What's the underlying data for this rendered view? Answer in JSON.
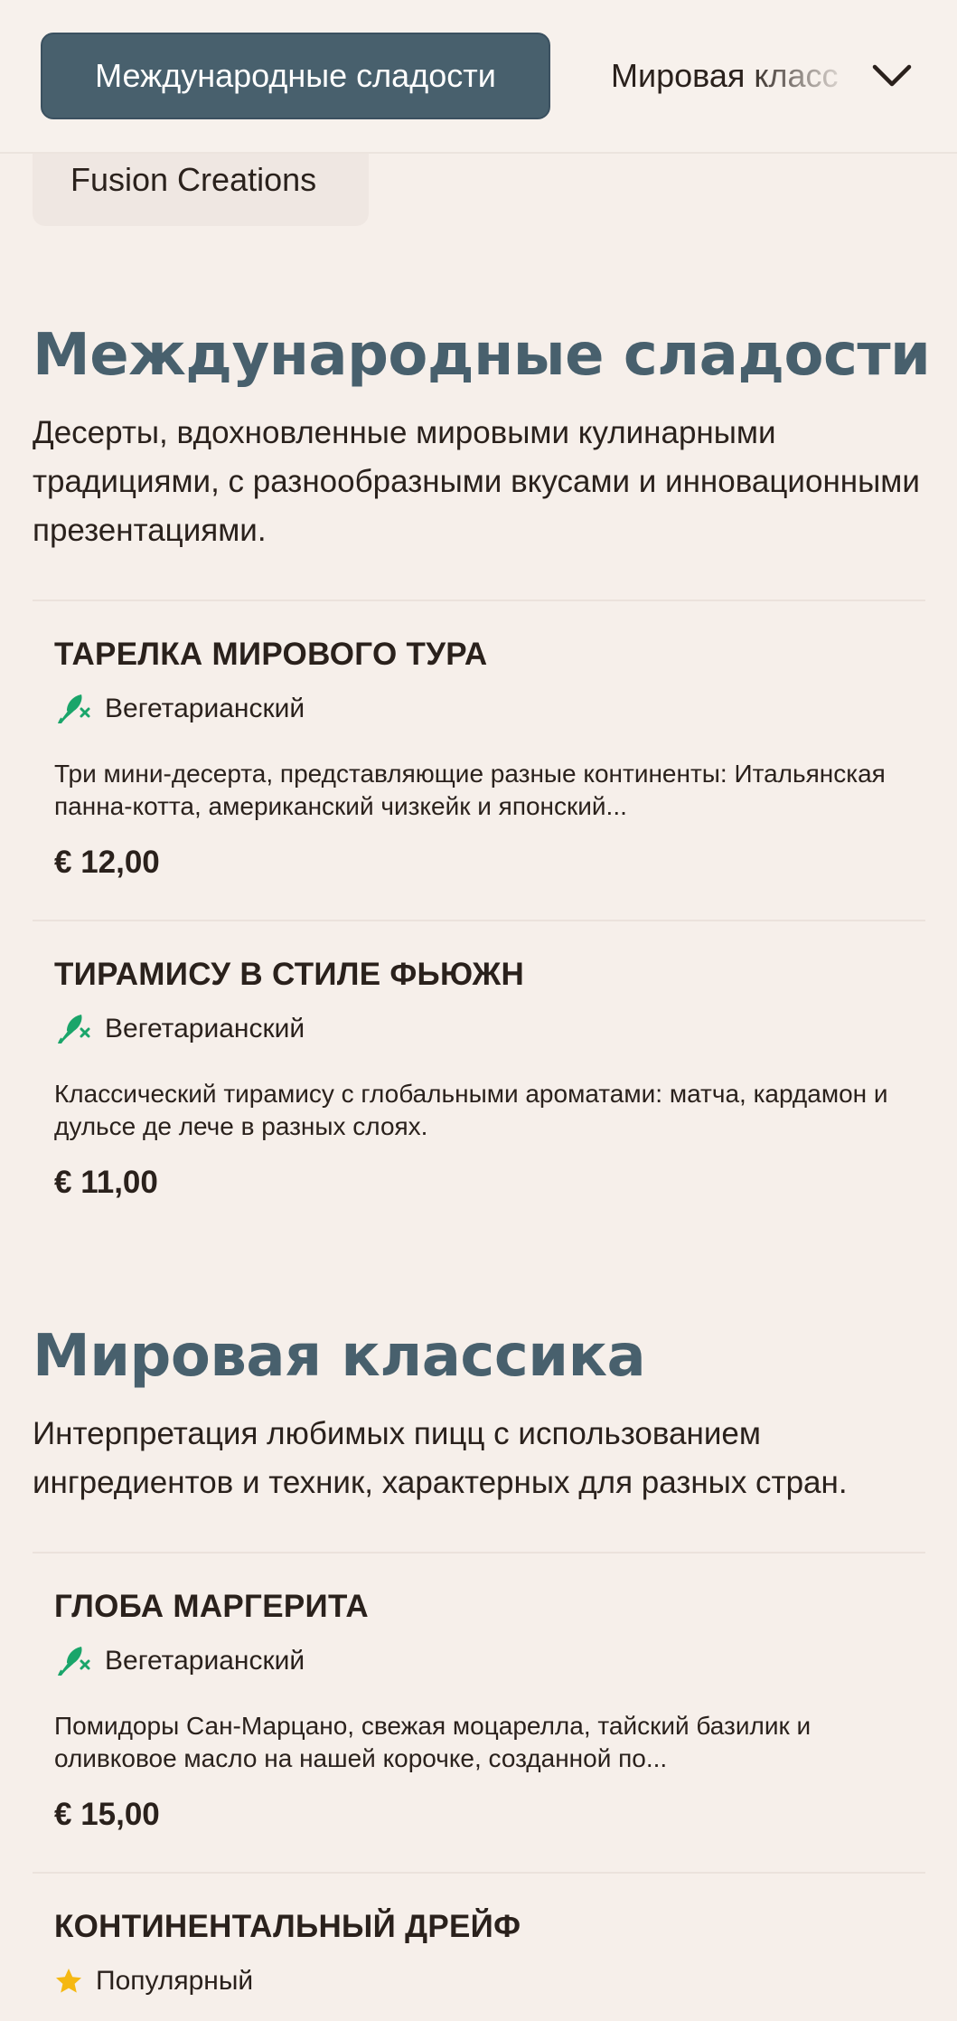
{
  "nav": {
    "active_tab": "Международные сладости",
    "next_tab": "Мировая класс",
    "chip": "Fusion Creations"
  },
  "sections": [
    {
      "title": "Международные сладости",
      "description": "Десерты, вдохновленные мировыми кулинарными традициями, с разнообразными вкусами и инновационными презентациями.",
      "items": [
        {
          "name": "ТАРЕЛКА МИРОВОГО ТУРА",
          "tag": "Вегетарианский",
          "tag_icon": "vegetarian-icon",
          "description": "Три мини-десерта, представляющие разные континенты: Итальянская панна-котта, американский чизкейк и японский...",
          "price": "€ 12,00"
        },
        {
          "name": "ТИРАМИСУ В СТИЛЕ ФЬЮЖН",
          "tag": "Вегетарианский",
          "tag_icon": "vegetarian-icon",
          "description": "Классический тирамису с глобальными ароматами: матча, кардамон и дульсе де лече в разных слоях.",
          "price": "€ 11,00"
        }
      ]
    },
    {
      "title": "Мировая классика",
      "description": "Интерпретация любимых пицц с использованием ингредиентов и техник, характерных для разных стран.",
      "items": [
        {
          "name": "ГЛОБА МАРГЕРИТА",
          "tag": "Вегетарианский",
          "tag_icon": "vegetarian-icon",
          "description": "Помидоры Сан-Марцано, свежая моцарелла, тайский базилик и оливковое масло на нашей корочке, созданной по...",
          "price": "€ 15,00"
        },
        {
          "name": "КОНТИНЕНТАЛЬНЫЙ ДРЕЙФ",
          "tag": "Популярный",
          "tag_icon": "star-icon"
        }
      ]
    }
  ],
  "colors": {
    "background": "#f6efea",
    "accent": "#48606d",
    "vegetarian": "#1aa56a",
    "star": "#f5b812"
  }
}
